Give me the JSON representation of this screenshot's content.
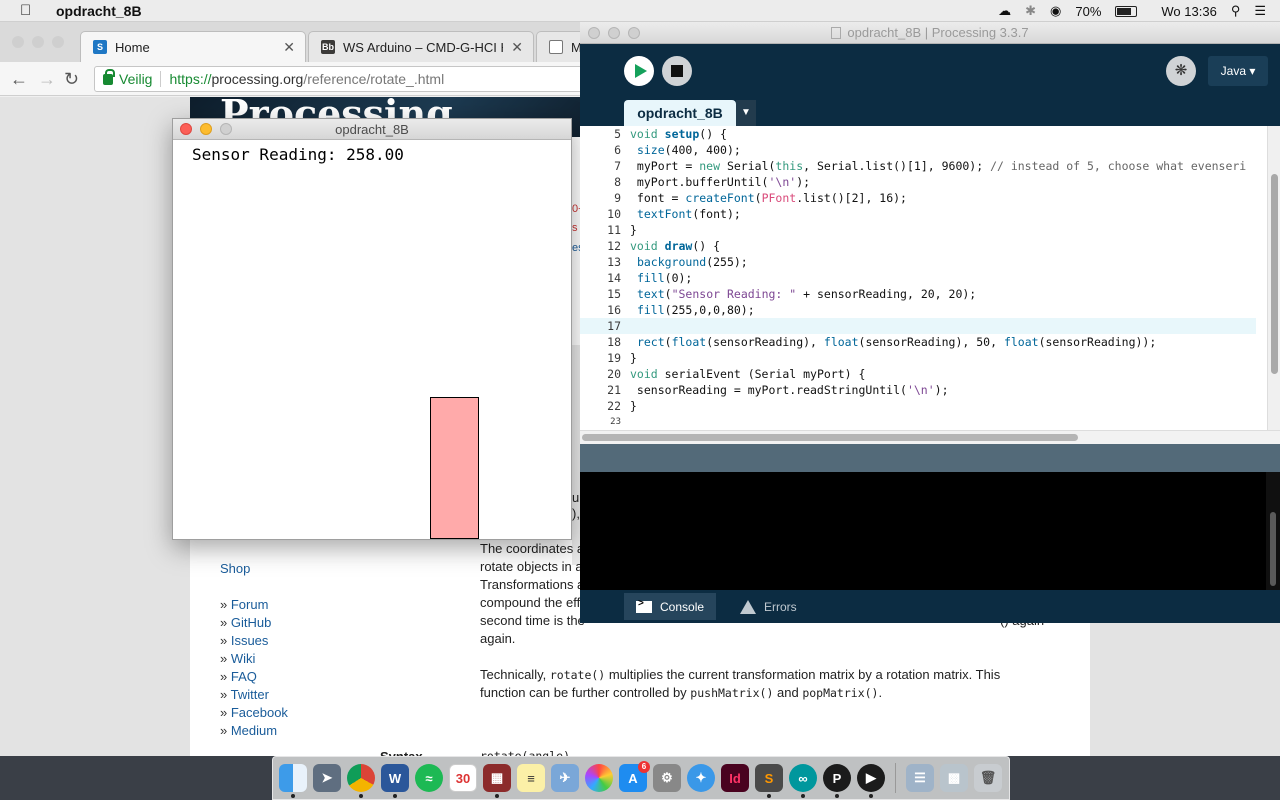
{
  "menubar": {
    "app_name": "opdracht_8B",
    "battery_percent": "70%",
    "clock": "Wo 13:36"
  },
  "browser": {
    "tabs": [
      {
        "label": "Home",
        "favicon": "sharepoint-icon"
      },
      {
        "label": "WS Arduino – CMD-G-HCI HCI",
        "favicon": "blackboard-icon"
      },
      {
        "label": "Mi",
        "favicon": "document-icon"
      }
    ],
    "security_label": "Veilig",
    "url_scheme": "https://",
    "url_host": "processing.org",
    "url_path": "/reference/rotate_.html",
    "page": {
      "logo": "Processing",
      "partial_top_text": [
        "0+",
        "s",
        "es"
      ],
      "shop_link": "Shop",
      "side_links": [
        "Forum",
        "GitHub",
        "Issues",
        "Wiki",
        "FAQ",
        "Twitter",
        "Facebook",
        "Medium"
      ],
      "partial_lines": [
        "u",
        "),"
      ],
      "description_lines": [
        "The coordinates a",
        "rotate objects in a",
        "Transformations a",
        "compound the eff",
        "second time is the",
        "again."
      ],
      "description_line5_tail": "() again",
      "technically_prefix": "Technically, ",
      "technically_code": "rotate()",
      "technically_mid": " multiplies the current transformation matrix by a rotation matrix. This",
      "technically_line2_prefix": "function can be further controlled by ",
      "push_matrix": "pushMatrix()",
      "and_text": " and ",
      "pop_matrix": "popMatrix()",
      "period": ".",
      "syntax_label": "Syntax",
      "syntax_value": "rotate(angle)"
    }
  },
  "sketch_window": {
    "title": "opdracht_8B",
    "reading_text": "Sensor Reading: 258.00",
    "sensor_value": 258,
    "bar_width": 50,
    "canvas_size": 400,
    "bar_fill": "#ffaaaa"
  },
  "ide": {
    "title": "opdracht_8B | Processing 3.3.7",
    "mode": "Java ▾",
    "sketch_tab": "opdracht_8B",
    "code_lines": [
      {
        "n": "5"
      },
      {
        "n": "6"
      },
      {
        "n": "7"
      },
      {
        "n": "8"
      },
      {
        "n": "9"
      },
      {
        "n": "10"
      },
      {
        "n": "11"
      },
      {
        "n": "12"
      },
      {
        "n": "13"
      },
      {
        "n": "14"
      },
      {
        "n": "15"
      },
      {
        "n": "16"
      },
      {
        "n": "17"
      },
      {
        "n": "18"
      },
      {
        "n": "19"
      },
      {
        "n": "20"
      },
      {
        "n": "21"
      },
      {
        "n": "22"
      },
      {
        "n": "23"
      }
    ],
    "footer_tabs": {
      "console": "Console",
      "errors": "Errors"
    },
    "colors": {
      "header": "#0c2c42",
      "console_bg": "#000000",
      "run_green": "#15a15b"
    }
  },
  "dock": {
    "calendar_day": "30",
    "app_store_badge": "6"
  }
}
